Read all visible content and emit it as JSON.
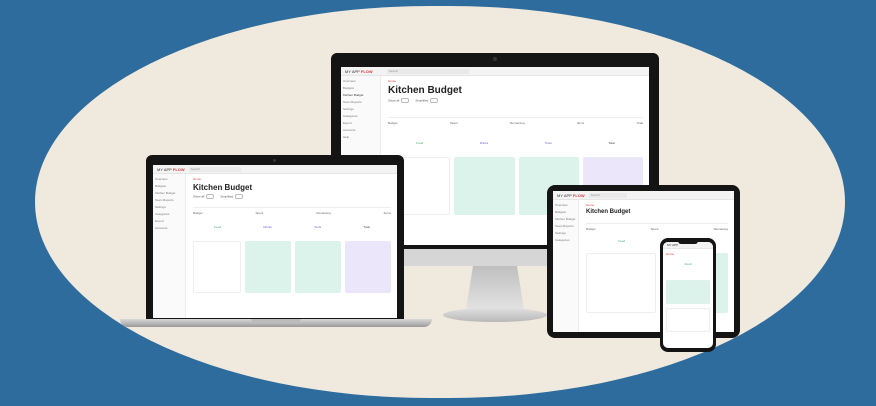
{
  "app": {
    "brand_first": "MY APP",
    "brand_accent": "FLOW",
    "search_placeholder": "Search"
  },
  "page": {
    "breadcrumb": "Home",
    "title": "Kitchen Budget",
    "toggle_label_a": "Show all",
    "toggle_label_b": "Simplified"
  },
  "sidebar": {
    "items": [
      "Overview",
      "Budgets",
      "Kitchen Budget",
      "Team Reports",
      "Settings",
      "Categories",
      "Export",
      "Accounts",
      "Help"
    ]
  },
  "stats": {
    "items": [
      "Budget",
      "Spent",
      "Remaining",
      "Items",
      "Total"
    ]
  },
  "summary": {
    "items": [
      "Food",
      "Drinks",
      "Tools",
      "Total"
    ]
  },
  "devices": [
    "desktop-monitor",
    "laptop",
    "tablet",
    "phone"
  ],
  "colors": {
    "background": "#2e6c9e",
    "blob": "#f0e9dd",
    "accent": "#d93a3a",
    "mint": "#dcf3ec",
    "lavender": "#ebe6fa"
  }
}
